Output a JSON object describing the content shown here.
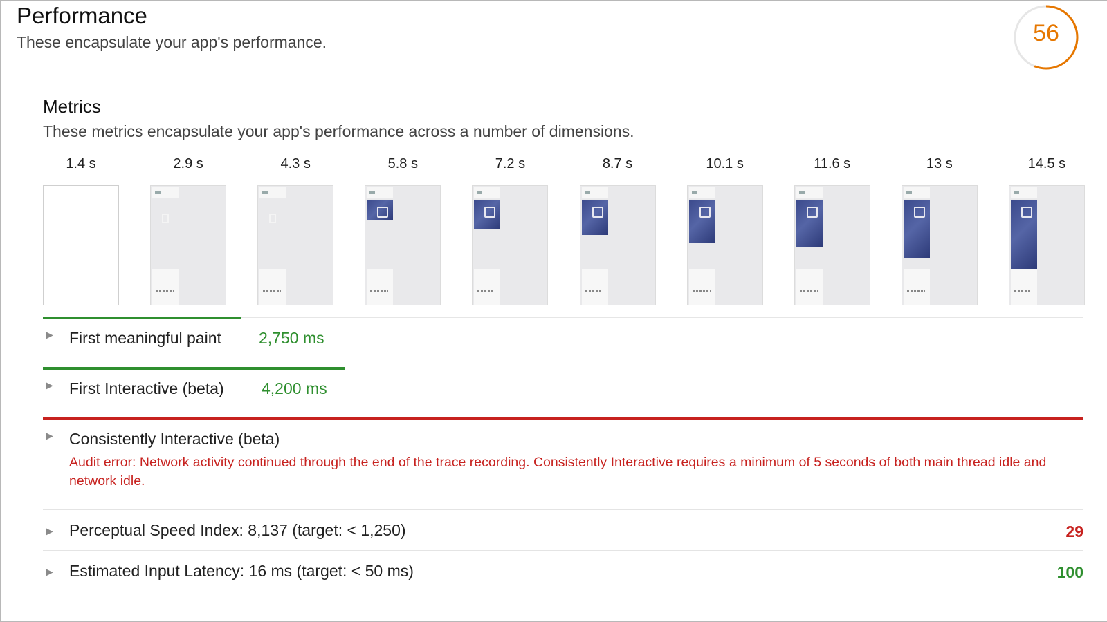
{
  "performance": {
    "title": "Performance",
    "subtitle": "These encapsulate your app's performance.",
    "score": "56",
    "score_fraction": 0.56,
    "score_color": "#e67700"
  },
  "metrics": {
    "title": "Metrics",
    "subtitle": "These metrics encapsulate your app's performance across a number of dimensions."
  },
  "filmstrip": {
    "frames": [
      {
        "time": "1.4 s",
        "loaded_fraction": 0
      },
      {
        "time": "2.9 s",
        "loaded_fraction": 0
      },
      {
        "time": "4.3 s",
        "loaded_fraction": 0
      },
      {
        "time": "5.8 s",
        "loaded_fraction": 0.15
      },
      {
        "time": "7.2 s",
        "loaded_fraction": 0.3
      },
      {
        "time": "8.7 s",
        "loaded_fraction": 0.4
      },
      {
        "time": "10.1 s",
        "loaded_fraction": 0.55
      },
      {
        "time": "11.6 s",
        "loaded_fraction": 0.62
      },
      {
        "time": "13 s",
        "loaded_fraction": 0.82
      },
      {
        "time": "14.5 s",
        "loaded_fraction": 1
      }
    ]
  },
  "metric_rows": {
    "fmp": {
      "label": "First meaningful paint",
      "value": "2,750 ms",
      "status": "good",
      "bar_fraction": 0.19
    },
    "fi": {
      "label": "First Interactive (beta)",
      "value": "4,200 ms",
      "status": "good",
      "bar_fraction": 0.29
    },
    "ci": {
      "label": "Consistently Interactive (beta)",
      "status": "error",
      "bar_fraction": 1,
      "error": "Audit error: Network activity continued through the end of the trace recording. Consistently Interactive requires a minimum of 5 seconds of both main thread idle and network idle."
    }
  },
  "score_rows": {
    "psi": {
      "label": "Perceptual Speed Index: 8,137 (target: < 1,250)",
      "score": "29",
      "color": "#c7221f"
    },
    "eil": {
      "label": "Estimated Input Latency: 16 ms (target: < 50 ms)",
      "score": "100",
      "color": "#2f8f2f"
    }
  },
  "colors": {
    "good": "#2f8f2f",
    "bad": "#c7221f",
    "average": "#e67700"
  },
  "icons": {
    "expand": "triangle-right-icon"
  }
}
